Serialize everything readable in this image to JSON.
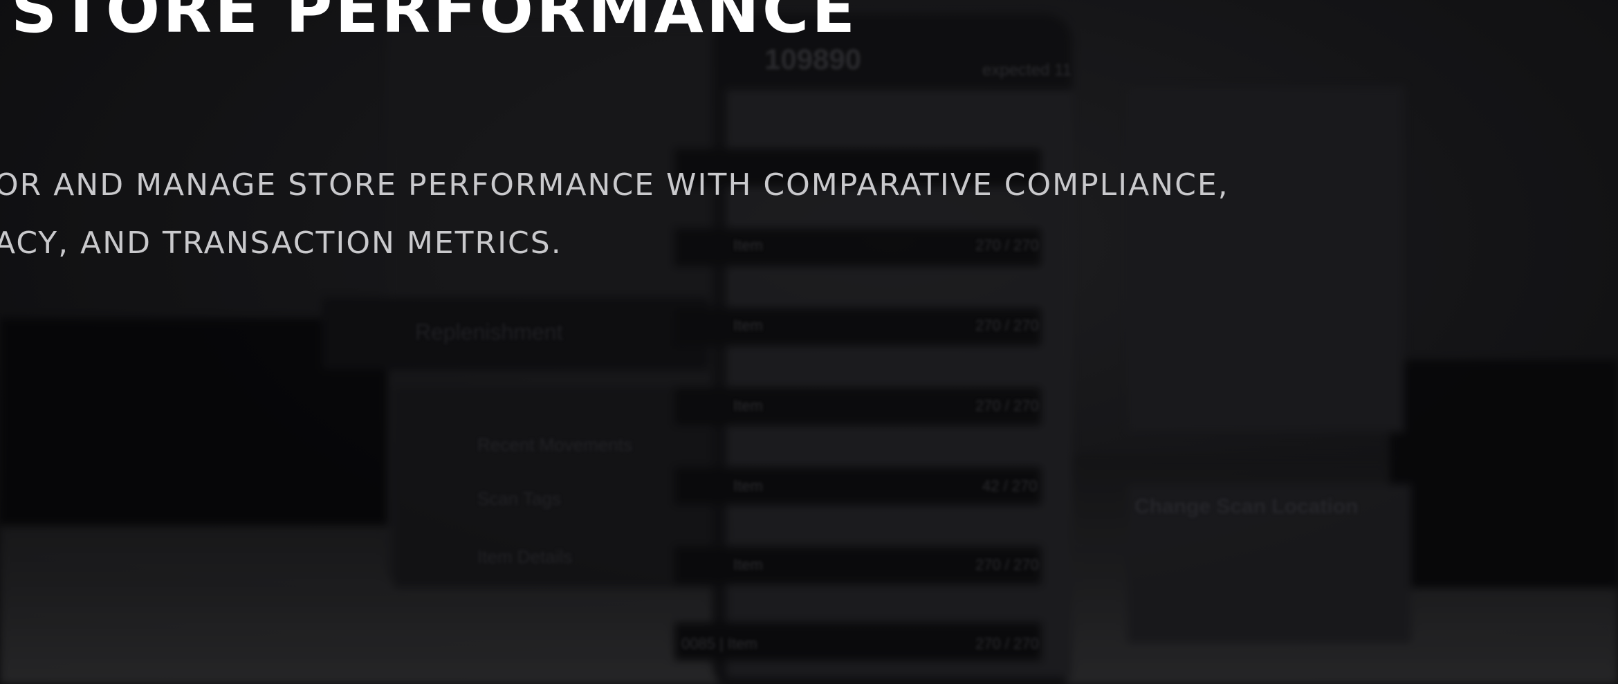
{
  "hero": {
    "title": "STORE PERFORMANCE",
    "description_lines": [
      "OR AND MANAGE STORE PERFORMANCE WITH COMPARATIVE COMPLIANCE,",
      "ACY, AND TRANSACTION METRICS."
    ]
  },
  "background_ui": {
    "counter_value": "109890",
    "expected_label": "expected 11",
    "menu_item": "Replenishment",
    "submenu_items": [
      "Recent Movements",
      "Scan Tags",
      "Item Details"
    ],
    "list_rows": [
      {
        "label": "Item",
        "count": "270 / 270"
      },
      {
        "label": "Item",
        "count": "270 / 270"
      },
      {
        "label": "Item",
        "count": "270 / 270"
      },
      {
        "label": "Item",
        "count": "42 / 270"
      },
      {
        "label": "Item",
        "count": "270 / 270"
      },
      {
        "label": "0085 | Item",
        "count": "270 / 270"
      }
    ],
    "side_button": "Change Scan Location",
    "colors": {
      "background": "#1c1c1e",
      "title": "#ffffff",
      "description": "#c9c9cc"
    }
  }
}
